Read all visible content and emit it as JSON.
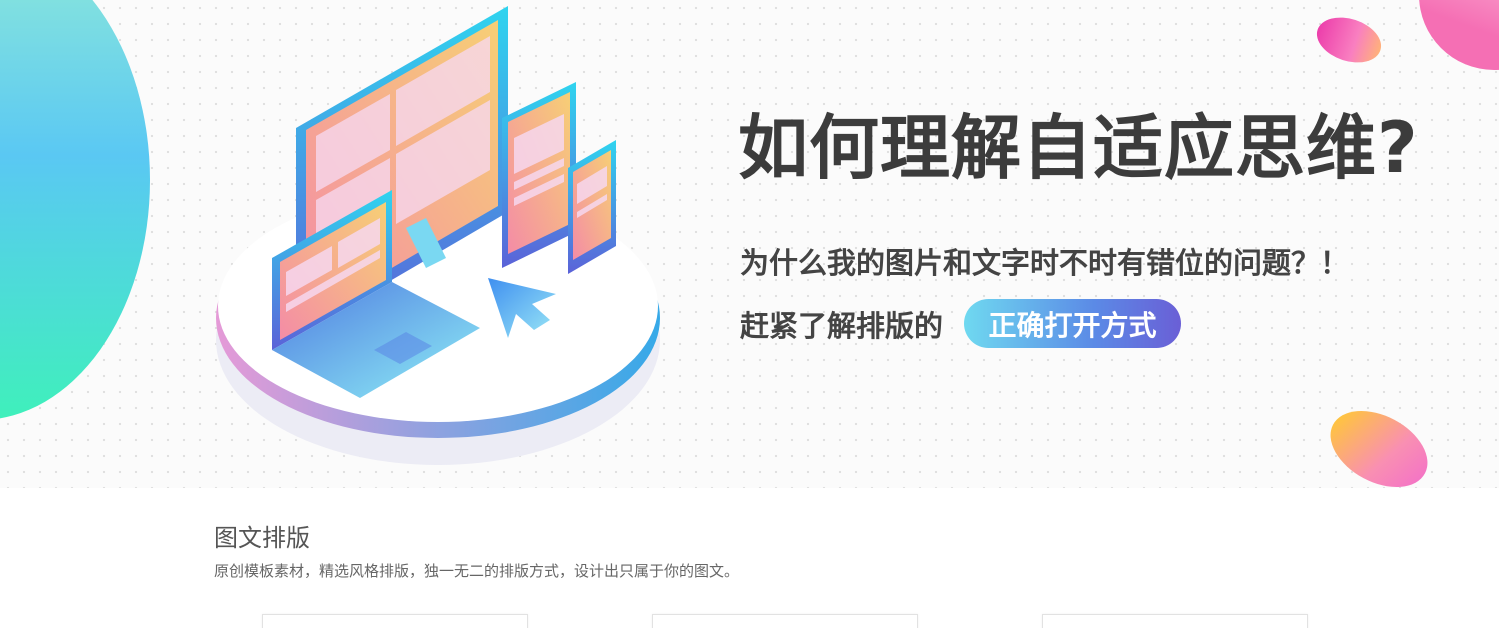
{
  "hero": {
    "title": "如何理解自适应思维?",
    "subtitle": "为什么我的图片和文字时不时有错位的问题？！",
    "cta_prefix": "赶紧了解排版的",
    "cta_label": "正确打开方式"
  },
  "section": {
    "title": "图文排版",
    "description": "原创模板素材，精选风格排版，独一无二的排版方式，设计出只属于你的图文。"
  },
  "cards": [
    {
      "id": "card-1"
    },
    {
      "id": "card-2"
    },
    {
      "id": "card-3"
    }
  ],
  "colors": {
    "title_text": "#3c3c3c",
    "pill_gradient_start": "#6fd9f0",
    "pill_gradient_end": "#6a5fd6",
    "blob_teal": "#3ff0bb",
    "blob_pink": "#ec3eab",
    "blob_orange": "#ffcc2e"
  },
  "icons": [
    "monitor-icon",
    "tablet-icon",
    "phone-icon",
    "laptop-icon",
    "cursor-arrow-icon"
  ]
}
